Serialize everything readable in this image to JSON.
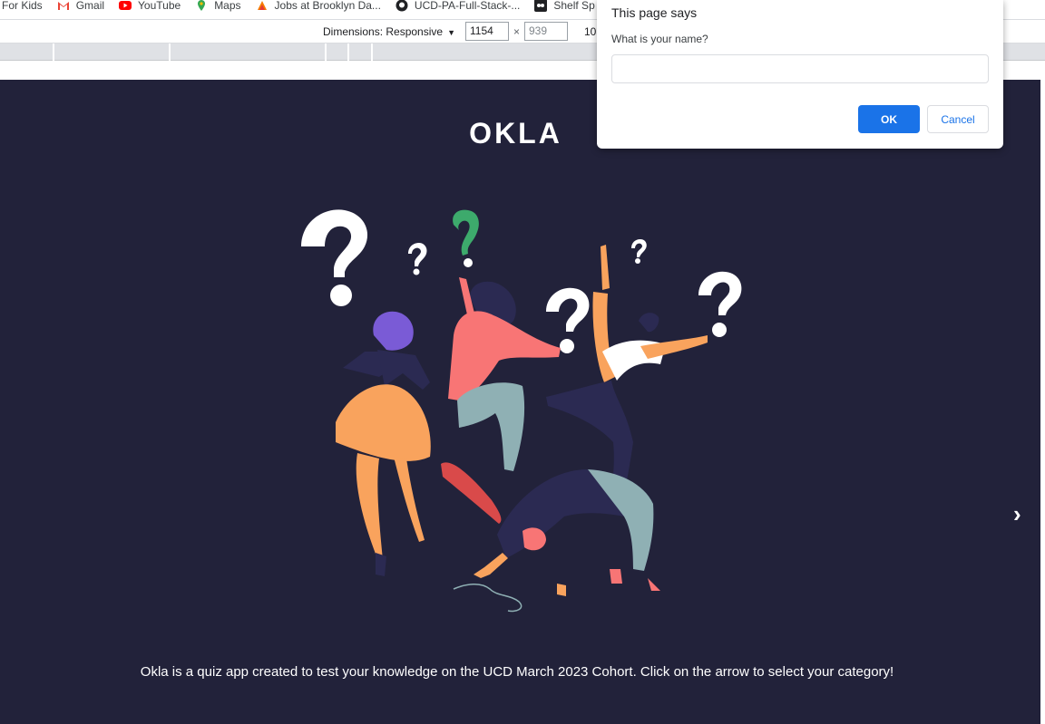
{
  "bookmarks": [
    {
      "label": "For Kids",
      "icon": "bookmark-icon"
    },
    {
      "label": "Gmail",
      "icon": "gmail-icon"
    },
    {
      "label": "YouTube",
      "icon": "youtube-icon"
    },
    {
      "label": "Maps",
      "icon": "maps-icon"
    },
    {
      "label": "Jobs at Brooklyn Da...",
      "icon": "jobs-icon"
    },
    {
      "label": "UCD-PA-Full-Stack-...",
      "icon": "github-icon"
    },
    {
      "label": "Shelf Sp",
      "icon": "shelf-icon"
    }
  ],
  "device_toolbar": {
    "dimensions_label": "Dimensions: Responsive",
    "width_value": "1154",
    "height_value": "939",
    "times": "×",
    "zoom": "10"
  },
  "page": {
    "title": "OKLA",
    "next_arrow": "›",
    "intro": "Okla is a quiz app created to test your knowledge on the UCD March 2023 Cohort. Click on the arrow to select your category!"
  },
  "dialog": {
    "title": "This page says",
    "message": "What is your name?",
    "input_value": "",
    "ok_label": "OK",
    "cancel_label": "Cancel"
  },
  "colors": {
    "page_bg": "#22223a",
    "accent_blue": "#1a73e8",
    "orange": "#f9a35d",
    "coral": "#f87575",
    "purple": "#7a5bd6",
    "teal": "#8fb0b4",
    "green": "#3daa6c",
    "navy": "#2b2a52"
  }
}
